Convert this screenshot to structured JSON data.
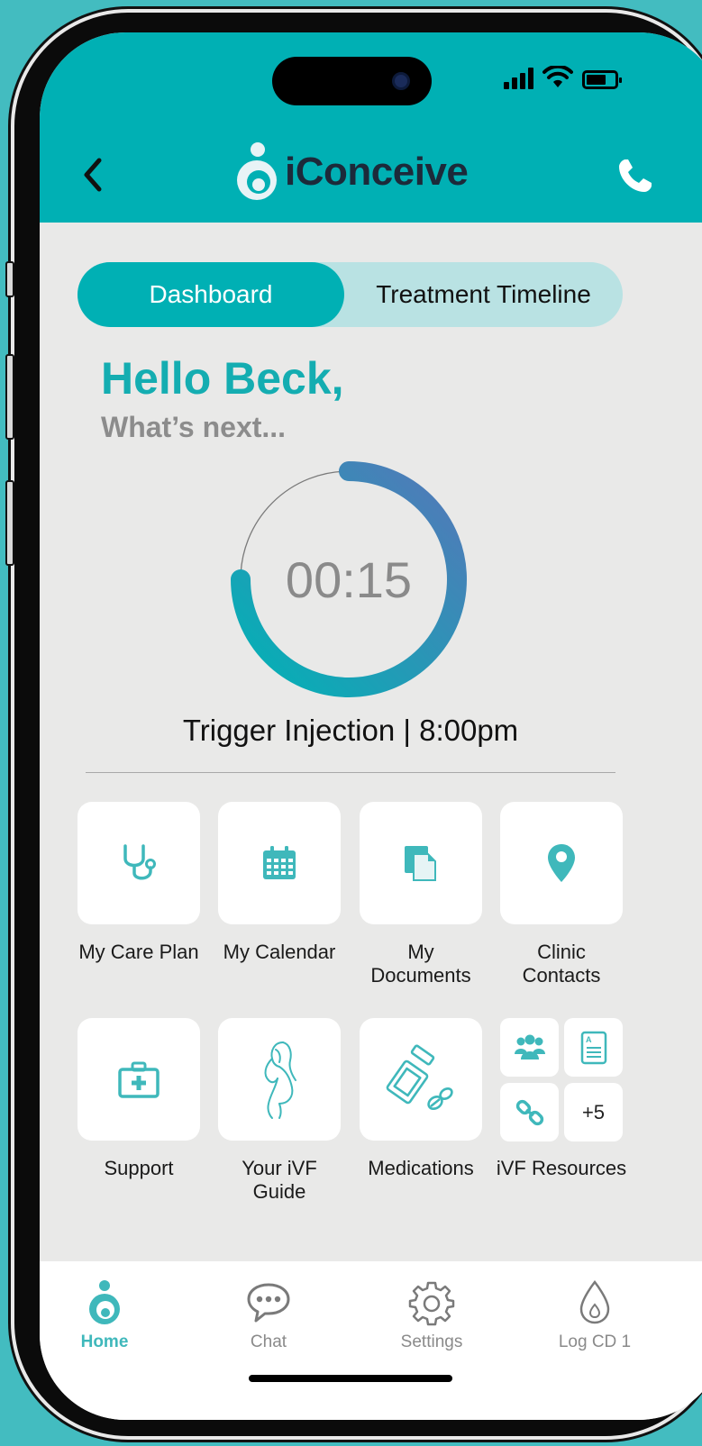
{
  "header": {
    "app_name": "iConceive",
    "back_icon": "chevron-left-icon",
    "call_icon": "phone-icon"
  },
  "segments": {
    "active": "Dashboard",
    "other": "Treatment Timeline"
  },
  "greeting": {
    "title": "Hello Beck,",
    "subtitle": "What’s next..."
  },
  "timer": {
    "value": "00:15",
    "progress": 0.75
  },
  "next_event": "Trigger Injection | 8:00pm",
  "tiles": [
    {
      "label": "My Care Plan",
      "icon": "stethoscope-icon"
    },
    {
      "label": "My Calendar",
      "icon": "calendar-icon"
    },
    {
      "label": "My\nDocuments",
      "icon": "documents-icon"
    },
    {
      "label": "Clinic\nContacts",
      "icon": "location-pin-icon"
    },
    {
      "label": "Support",
      "icon": "first-aid-kit-icon"
    },
    {
      "label": "Your iVF\nGuide",
      "icon": "pregnant-woman-icon"
    },
    {
      "label": "Medications",
      "icon": "pill-bottle-icon"
    },
    {
      "label": "iVF Resources",
      "icon": "resources-icon"
    }
  ],
  "resources_more": "+5",
  "tabbar": [
    {
      "label": "Home",
      "icon": "home-icon",
      "active": true
    },
    {
      "label": "Chat",
      "icon": "chat-icon"
    },
    {
      "label": "Settings",
      "icon": "gear-icon"
    },
    {
      "label": "Log CD 1",
      "icon": "drop-icon"
    }
  ],
  "colors": {
    "brand": "#00b0b4",
    "segment_bg": "#b9e2e3",
    "background": "#e9e9e8",
    "greeting": "#14adb1",
    "icon": "#3fb8bb"
  }
}
